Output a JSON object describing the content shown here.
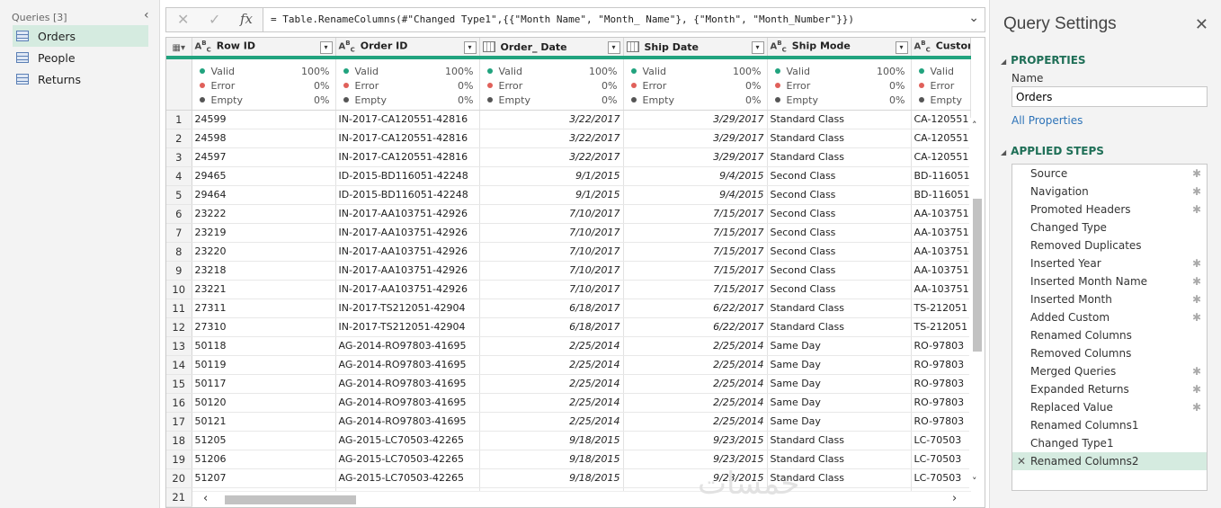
{
  "queries": {
    "header": "Queries [3]",
    "items": [
      {
        "label": "Orders",
        "selected": true
      },
      {
        "label": "People",
        "selected": false
      },
      {
        "label": "Returns",
        "selected": false
      }
    ]
  },
  "formula_bar": {
    "fx_label": "fx",
    "formula": "= Table.RenameColumns(#\"Changed Type1\",{{\"Month Name\", \"Month_ Name\"}, {\"Month\", \"Month_Number\"}})"
  },
  "columns": [
    {
      "name": "Row ID",
      "type": "ABC",
      "valid": "100%",
      "error": "0%",
      "empty": "0%"
    },
    {
      "name": "Order ID",
      "type": "ABC",
      "valid": "100%",
      "error": "0%",
      "empty": "0%"
    },
    {
      "name": "Order_ Date",
      "type": "date",
      "valid": "100%",
      "error": "0%",
      "empty": "0%"
    },
    {
      "name": "Ship Date",
      "type": "date",
      "valid": "100%",
      "error": "0%",
      "empty": "0%"
    },
    {
      "name": "Ship Mode",
      "type": "ABC",
      "valid": "100%",
      "error": "0%",
      "empty": "0%"
    },
    {
      "name": "Customer ID",
      "type": "ABC",
      "valid": "",
      "error": "",
      "empty": ""
    }
  ],
  "quality_labels": {
    "valid": "Valid",
    "error": "Error",
    "empty": "Empty"
  },
  "colors": {
    "valid": "#21a37e",
    "error": "#e0605a",
    "empty": "#555555",
    "accent": "#21a37e"
  },
  "rows": [
    [
      "1",
      "24599",
      "IN-2017-CA120551-42816",
      "3/22/2017",
      "3/29/2017",
      "Standard Class",
      "CA-120551"
    ],
    [
      "2",
      "24598",
      "IN-2017-CA120551-42816",
      "3/22/2017",
      "3/29/2017",
      "Standard Class",
      "CA-120551"
    ],
    [
      "3",
      "24597",
      "IN-2017-CA120551-42816",
      "3/22/2017",
      "3/29/2017",
      "Standard Class",
      "CA-120551"
    ],
    [
      "4",
      "29465",
      "ID-2015-BD116051-42248",
      "9/1/2015",
      "9/4/2015",
      "Second Class",
      "BD-116051"
    ],
    [
      "5",
      "29464",
      "ID-2015-BD116051-42248",
      "9/1/2015",
      "9/4/2015",
      "Second Class",
      "BD-116051"
    ],
    [
      "6",
      "23222",
      "IN-2017-AA103751-42926",
      "7/10/2017",
      "7/15/2017",
      "Second Class",
      "AA-103751"
    ],
    [
      "7",
      "23219",
      "IN-2017-AA103751-42926",
      "7/10/2017",
      "7/15/2017",
      "Second Class",
      "AA-103751"
    ],
    [
      "8",
      "23220",
      "IN-2017-AA103751-42926",
      "7/10/2017",
      "7/15/2017",
      "Second Class",
      "AA-103751"
    ],
    [
      "9",
      "23218",
      "IN-2017-AA103751-42926",
      "7/10/2017",
      "7/15/2017",
      "Second Class",
      "AA-103751"
    ],
    [
      "10",
      "23221",
      "IN-2017-AA103751-42926",
      "7/10/2017",
      "7/15/2017",
      "Second Class",
      "AA-103751"
    ],
    [
      "11",
      "27311",
      "IN-2017-TS212051-42904",
      "6/18/2017",
      "6/22/2017",
      "Standard Class",
      "TS-212051"
    ],
    [
      "12",
      "27310",
      "IN-2017-TS212051-42904",
      "6/18/2017",
      "6/22/2017",
      "Standard Class",
      "TS-212051"
    ],
    [
      "13",
      "50118",
      "AG-2014-RO97803-41695",
      "2/25/2014",
      "2/25/2014",
      "Same Day",
      "RO-97803"
    ],
    [
      "14",
      "50119",
      "AG-2014-RO97803-41695",
      "2/25/2014",
      "2/25/2014",
      "Same Day",
      "RO-97803"
    ],
    [
      "15",
      "50117",
      "AG-2014-RO97803-41695",
      "2/25/2014",
      "2/25/2014",
      "Same Day",
      "RO-97803"
    ],
    [
      "16",
      "50120",
      "AG-2014-RO97803-41695",
      "2/25/2014",
      "2/25/2014",
      "Same Day",
      "RO-97803"
    ],
    [
      "17",
      "50121",
      "AG-2014-RO97803-41695",
      "2/25/2014",
      "2/25/2014",
      "Same Day",
      "RO-97803"
    ],
    [
      "18",
      "51205",
      "AG-2015-LC70503-42265",
      "9/18/2015",
      "9/23/2015",
      "Standard Class",
      "LC-70503"
    ],
    [
      "19",
      "51206",
      "AG-2015-LC70503-42265",
      "9/18/2015",
      "9/23/2015",
      "Standard Class",
      "LC-70503"
    ],
    [
      "20",
      "51207",
      "AG-2015-LC70503-42265",
      "9/18/2015",
      "9/23/2015",
      "Standard Class",
      "LC-70503"
    ],
    [
      "21",
      "",
      "",
      "",
      "",
      "",
      ""
    ]
  ],
  "settings": {
    "title": "Query Settings",
    "properties_header": "PROPERTIES",
    "name_label": "Name",
    "name_value": "Orders",
    "all_properties": "All Properties",
    "steps_header": "APPLIED STEPS",
    "steps": [
      {
        "label": "Source",
        "gear": true,
        "selected": false
      },
      {
        "label": "Navigation",
        "gear": true,
        "selected": false
      },
      {
        "label": "Promoted Headers",
        "gear": true,
        "selected": false
      },
      {
        "label": "Changed Type",
        "gear": false,
        "selected": false
      },
      {
        "label": "Removed Duplicates",
        "gear": false,
        "selected": false
      },
      {
        "label": "Inserted Year",
        "gear": true,
        "selected": false
      },
      {
        "label": "Inserted Month Name",
        "gear": true,
        "selected": false
      },
      {
        "label": "Inserted Month",
        "gear": true,
        "selected": false
      },
      {
        "label": "Added Custom",
        "gear": true,
        "selected": false
      },
      {
        "label": "Renamed Columns",
        "gear": false,
        "selected": false
      },
      {
        "label": "Removed Columns",
        "gear": false,
        "selected": false
      },
      {
        "label": "Merged Queries",
        "gear": true,
        "selected": false
      },
      {
        "label": "Expanded Returns",
        "gear": true,
        "selected": false
      },
      {
        "label": "Replaced Value",
        "gear": true,
        "selected": false
      },
      {
        "label": "Renamed Columns1",
        "gear": false,
        "selected": false
      },
      {
        "label": "Changed Type1",
        "gear": false,
        "selected": false
      },
      {
        "label": "Renamed Columns2",
        "gear": false,
        "selected": true
      }
    ]
  },
  "watermark": "خمسات"
}
